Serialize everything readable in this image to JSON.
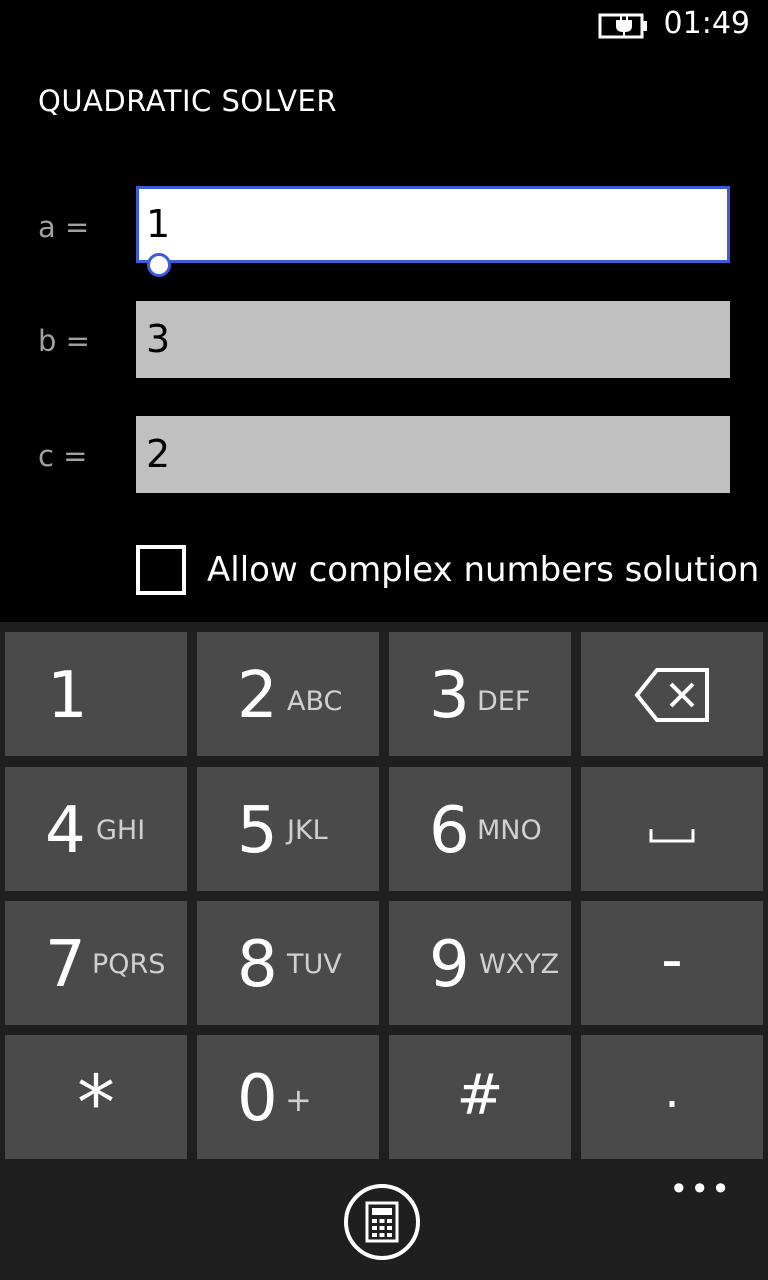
{
  "status_bar": {
    "time": "01:49",
    "battery_icon": "battery-charging-icon"
  },
  "app": {
    "title": "QUADRATIC SOLVER"
  },
  "form": {
    "a_label": "a =",
    "a_value": "1",
    "b_label": "b =",
    "b_value": "3",
    "c_label": "c =",
    "c_value": "2",
    "complex_checkbox_label": "Allow complex numbers solution",
    "complex_checked": false
  },
  "keypad": {
    "keys": [
      {
        "digit": "1",
        "letters": ""
      },
      {
        "digit": "2",
        "letters": "ABC"
      },
      {
        "digit": "3",
        "letters": "DEF"
      },
      {
        "digit": "4",
        "letters": "GHI"
      },
      {
        "digit": "5",
        "letters": "JKL"
      },
      {
        "digit": "6",
        "letters": "MNO"
      },
      {
        "digit": "7",
        "letters": "PQRS"
      },
      {
        "digit": "8",
        "letters": "TUV"
      },
      {
        "digit": "9",
        "letters": "WXYZ"
      },
      {
        "digit": "0",
        "letters": "+"
      }
    ],
    "star": "*",
    "hash": "#",
    "minus": "-",
    "dot": ".",
    "backspace_icon": "backspace-icon",
    "space_icon": "space-icon"
  },
  "app_bar": {
    "more": "•••",
    "calc_icon": "calculator-icon"
  },
  "colors": {
    "accent": "#3d5ad8",
    "key_bg": "#4a4a4a",
    "panel_bg": "#1f1f1f",
    "field_bg": "#c0c0c0"
  }
}
